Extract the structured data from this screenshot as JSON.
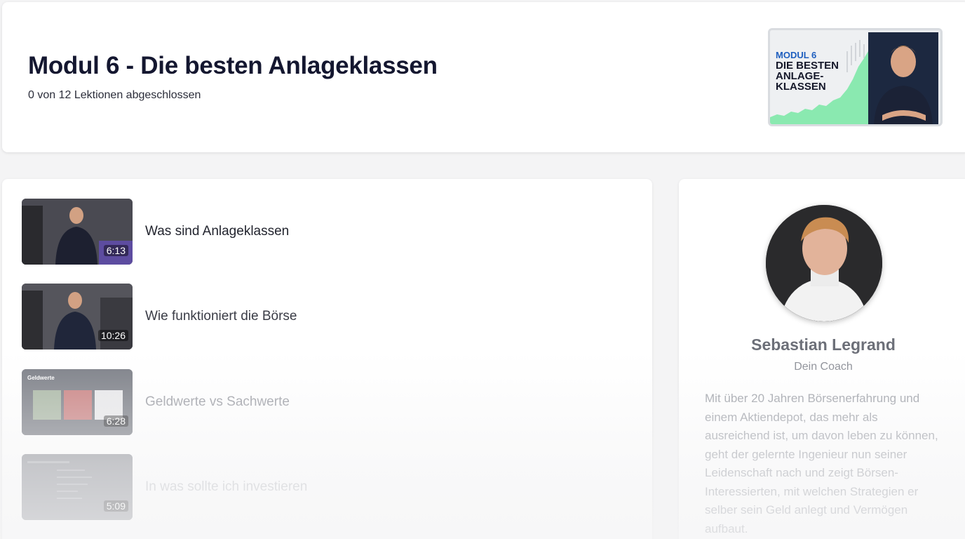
{
  "module": {
    "title": "Modul 6 - Die besten Anlageklassen",
    "progress": "0 von 12 Lektionen abgeschlossen",
    "thumbnail": {
      "line1": "MODUL 6",
      "line2a": "DIE BESTEN",
      "line2b": "ANLAGE-",
      "line2c": "KLASSEN",
      "accent": "#1f5fbf",
      "chart_color": "#6ee7a0"
    }
  },
  "lessons": [
    {
      "title": "Was sind Anlageklassen",
      "duration": "6:13",
      "thumb_icon": "video-thumbnail-icon"
    },
    {
      "title": "Wie funktioniert die Börse",
      "duration": "10:26",
      "thumb_icon": "video-thumbnail-icon"
    },
    {
      "title": "Geldwerte vs Sachwerte",
      "duration": "6:28",
      "thumb_icon": "slide-thumbnail-icon",
      "slide_heading": "Geldwerte"
    },
    {
      "title": "In was sollte ich investieren",
      "duration": "5:09",
      "thumb_icon": "slide-thumbnail-icon"
    }
  ],
  "coach": {
    "name": "Sebastian Legrand",
    "role": "Dein Coach",
    "bio": "Mit über 20 Jahren Börsenerfahrung und einem Aktiendepot, das mehr als ausreichend ist, um davon leben zu können, geht der gelernte Ingenieur nun seiner Leidenschaft nach und zeigt Börsen-Interessierten, mit welchen Strategien er selber sein Geld anlegt und Vermögen aufbaut."
  }
}
